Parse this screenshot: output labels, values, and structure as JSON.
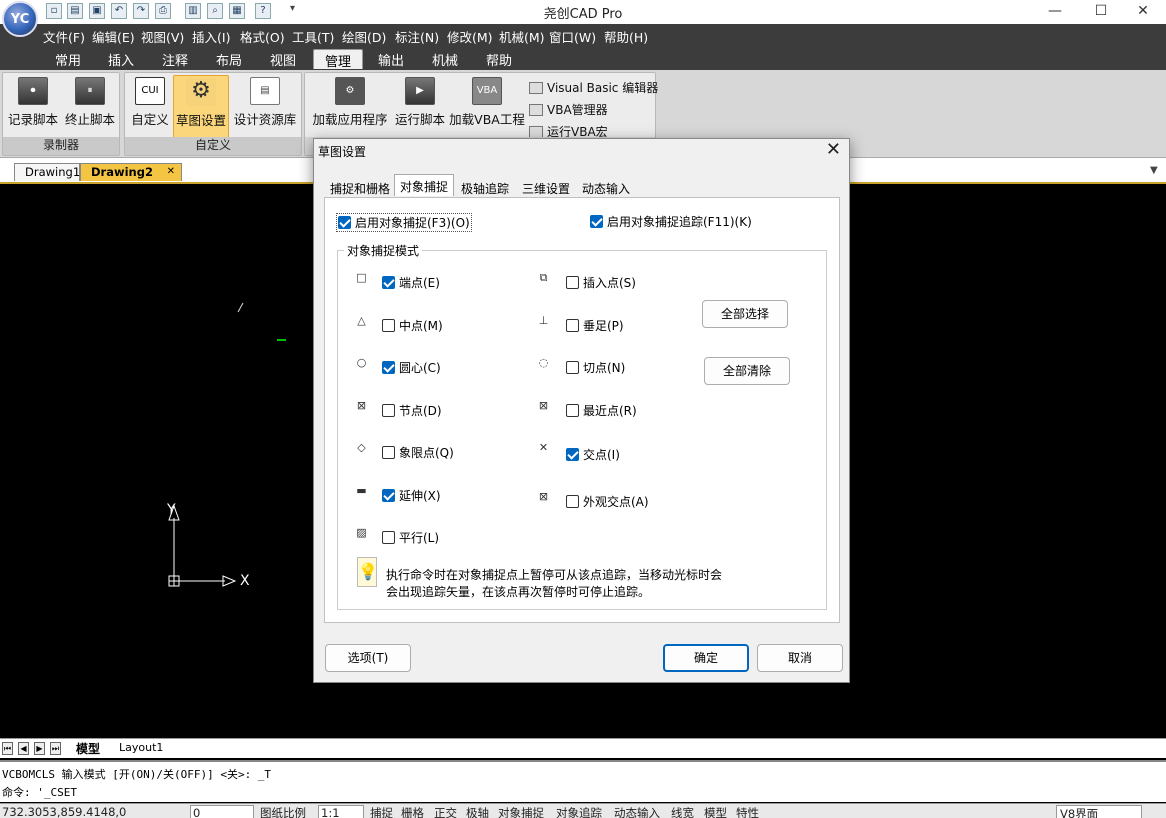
{
  "app": {
    "title": "尧创CAD Pro",
    "logo_text": "YC"
  },
  "window": {
    "minimize": "—",
    "maximize": "☐",
    "close": "✕"
  },
  "menus": [
    "文件(F)",
    "编辑(E)",
    "视图(V)",
    "插入(I)",
    "格式(O)",
    "工具(T)",
    "绘图(D)",
    "标注(N)",
    "修改(M)",
    "机械(M)",
    "窗口(W)",
    "帮助(H)"
  ],
  "ribbon_tabs": [
    "常用",
    "插入",
    "注释",
    "布局",
    "视图",
    "管理",
    "输出",
    "机械",
    "帮助"
  ],
  "ribbon_active_tab": "管理",
  "ribbon": {
    "recorder": {
      "label": "录制器",
      "buttons": [
        "记录脚本",
        "终止脚本"
      ]
    },
    "customize": {
      "label": "自定义",
      "buttons": [
        "自定义",
        "草图设置",
        "设计资源库"
      ],
      "cui_text": "CUI"
    },
    "apps": {
      "buttons": [
        "加载应用程序",
        "运行脚本",
        "加载VBA工程"
      ],
      "vba_text": "VBA",
      "small_buttons": [
        "Visual Basic 编辑器",
        "VBA管理器",
        "运行VBA宏"
      ]
    }
  },
  "doc_tabs": [
    "Drawing1",
    "Drawing2"
  ],
  "doc_tab_close": "✕",
  "doc_tab_menu": "▼",
  "canvas": {
    "ucs_x": "X",
    "ucs_y": "Y"
  },
  "layout_tabs": [
    "模型",
    "Layout1"
  ],
  "command_lines": [
    "VCBOMCLS 输入模式 [开(ON)/关(OFF)] <关>: _T",
    "命令: '_CSET"
  ],
  "status": {
    "coords": "732.3053,859.4148,0",
    "layer": "0",
    "scale_label": "图纸比例",
    "scale": "1:1",
    "toggles": [
      "捕捉",
      "栅格",
      "正交",
      "极轴",
      "对象捕捉",
      "对象追踪",
      "动态输入",
      "线宽",
      "模型",
      "特性"
    ],
    "workspace": "V8界面"
  },
  "dialog": {
    "title": "草图设置",
    "close": "✕",
    "tabs": [
      "捕捉和栅格",
      "对象捕捉",
      "极轴追踪",
      "三维设置",
      "动态输入"
    ],
    "active_tab": "对象捕捉",
    "enable_osnap": {
      "label": "启用对象捕捉(F3)(O)",
      "checked": true
    },
    "enable_tracking": {
      "label": "启用对象捕捉追踪(F11)(K)",
      "checked": true
    },
    "group_title": "对象捕捉模式",
    "modes_left": [
      {
        "label": "端点(E)",
        "checked": true,
        "icon": "endpoint-icon"
      },
      {
        "label": "中点(M)",
        "checked": false,
        "icon": "midpoint-icon"
      },
      {
        "label": "圆心(C)",
        "checked": true,
        "icon": "center-icon"
      },
      {
        "label": "节点(D)",
        "checked": false,
        "icon": "node-icon"
      },
      {
        "label": "象限点(Q)",
        "checked": false,
        "icon": "quadrant-icon"
      },
      {
        "label": "延伸(X)",
        "checked": true,
        "icon": "extension-icon"
      },
      {
        "label": "平行(L)",
        "checked": false,
        "icon": "parallel-icon"
      }
    ],
    "modes_right": [
      {
        "label": "插入点(S)",
        "checked": false,
        "icon": "insertion-icon"
      },
      {
        "label": "垂足(P)",
        "checked": false,
        "icon": "perpendicular-icon"
      },
      {
        "label": "切点(N)",
        "checked": false,
        "icon": "tangent-icon"
      },
      {
        "label": "最近点(R)",
        "checked": false,
        "icon": "nearest-icon"
      },
      {
        "label": "交点(I)",
        "checked": true,
        "icon": "intersection-icon"
      },
      {
        "label": "外观交点(A)",
        "checked": false,
        "icon": "apparent-intersection-icon"
      }
    ],
    "select_all": "全部选择",
    "clear_all": "全部清除",
    "hint_line1": "执行命令时在对象捕捉点上暂停可从该点追踪，当移动光标时会",
    "hint_line2": "会出现追踪矢量，在该点再次暂停时可停止追踪。",
    "options_button": "选项(T)",
    "ok_button": "确定",
    "cancel_button": "取消"
  }
}
